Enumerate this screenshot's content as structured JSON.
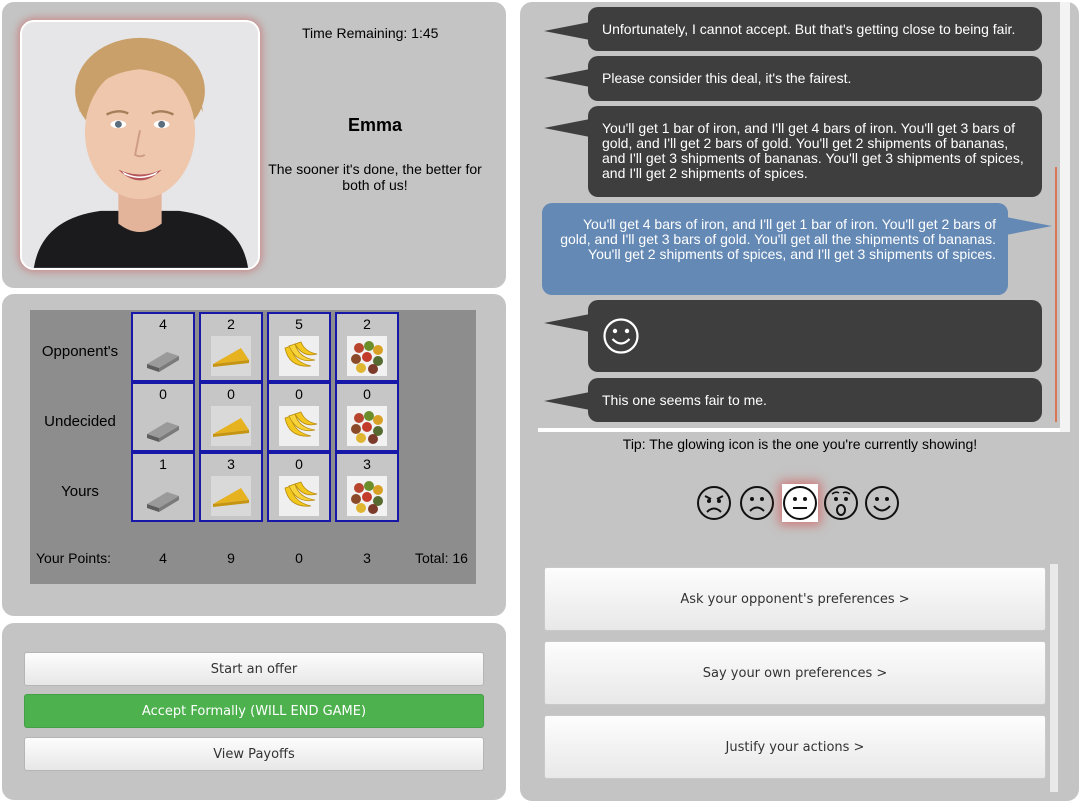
{
  "opponent": {
    "timer": "Time Remaining: 1:45",
    "name": "Emma",
    "message": "The sooner it's done, the better for both of us!",
    "photo_frame_glow": "#c85a5a"
  },
  "board": {
    "row_labels": [
      "Opponent's",
      "Undecided",
      "Yours"
    ],
    "items": [
      {
        "name": "iron",
        "icon": "iron-bar-icon",
        "opponent": "4",
        "undecided": "0",
        "yours": "1",
        "points": "4"
      },
      {
        "name": "gold",
        "icon": "gold-bar-icon",
        "opponent": "2",
        "undecided": "0",
        "yours": "3",
        "points": "9"
      },
      {
        "name": "bananas",
        "icon": "bananas-icon",
        "opponent": "5",
        "undecided": "0",
        "yours": "0",
        "points": "0"
      },
      {
        "name": "spices",
        "icon": "spices-icon",
        "opponent": "2",
        "undecided": "0",
        "yours": "3",
        "points": "3"
      }
    ],
    "points_label": "Your Points:",
    "total": "Total: 16",
    "cell_border_color": "#1818a8"
  },
  "actions": {
    "start_offer": "Start an offer",
    "accept": "Accept Formally (WILL END GAME)",
    "view_payoffs": "View Payoffs",
    "accept_color": "#4db14e"
  },
  "chat": {
    "messages": [
      {
        "from": "opponent",
        "text": "Unfortunately, I cannot accept. But that's getting close to being fair."
      },
      {
        "from": "opponent",
        "text": "Please consider this deal, it's the fairest."
      },
      {
        "from": "opponent",
        "text": "You'll get 1 bar of iron, and I'll get 4 bars of iron. You'll get 3 bars of gold, and I'll get 2 bars of gold. You'll get 2 shipments of bananas, and I'll get 3 shipments of bananas. You'll get 3 shipments of spices, and I'll get 2 shipments of spices."
      },
      {
        "from": "me",
        "text": "You'll get 4 bars of iron, and I'll get 1 bar of iron. You'll get 2 bars of gold, and I'll get 3 bars of gold. You'll get all the shipments of bananas. You'll get 2 shipments of spices, and I'll get 3 shipments of spices."
      },
      {
        "from": "opponent",
        "emoji": "smile-emoji-icon"
      },
      {
        "from": "opponent",
        "text": "This one seems fair to me."
      }
    ],
    "opponent_bubble_color": "#3e3e3e",
    "my_bubble_color": "#6489b5",
    "tip": "Tip: The glowing icon is the one you're currently showing!",
    "emojis": [
      "angry-emoji-icon",
      "sad-emoji-icon",
      "neutral-emoji-icon",
      "surprised-emoji-icon",
      "happy-emoji-icon"
    ],
    "selected_emoji": "neutral-emoji-icon",
    "pref_buttons": [
      "Ask your opponent's preferences >",
      "Say your own preferences >",
      "Justify your actions >"
    ]
  }
}
